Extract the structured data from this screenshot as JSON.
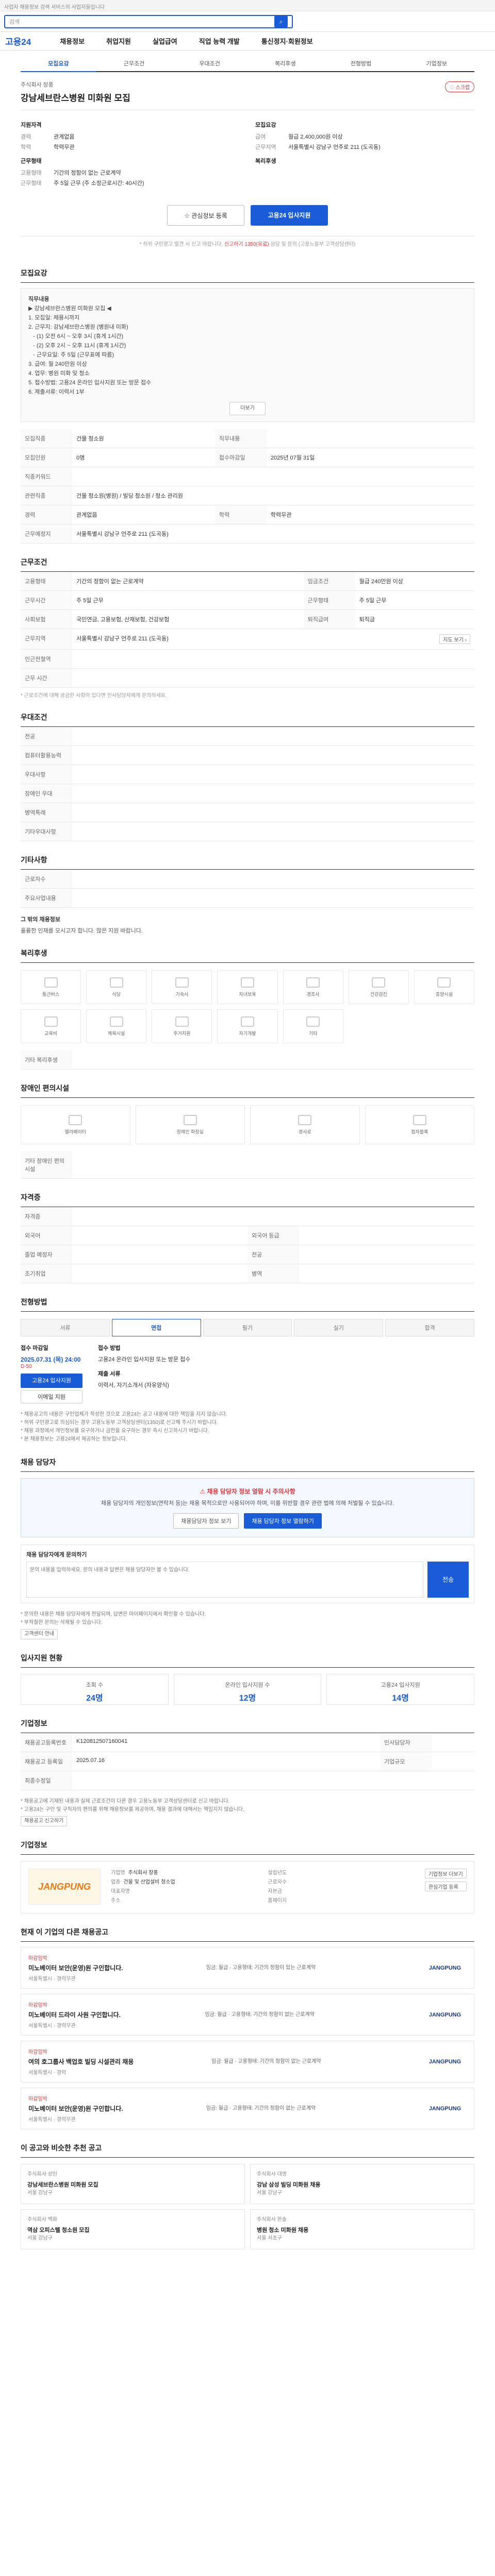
{
  "topbar": {
    "text": "사업자 채용정보 검색 서비스의 사업자들입니다"
  },
  "search": {
    "placeholder": "검색"
  },
  "gnb": {
    "logo": "고용24",
    "items": [
      "채용정보",
      "취업지원",
      "실업급여",
      "직업 능력 개발",
      "통신정지·회원정보"
    ]
  },
  "tabs": [
    "모집요강",
    "근무조건",
    "우대조건",
    "복리후생",
    "전형방법",
    "기업정보"
  ],
  "head": {
    "company": "주식회사 장풍",
    "title": "강남세브란스병원 미화원 모집",
    "scrap": "스크랩"
  },
  "summary": {
    "left_title": "지원자격",
    "left": [
      {
        "k": "경력",
        "v": "관계없음"
      },
      {
        "k": "학력",
        "v": "학력무관"
      }
    ],
    "left_title2": "근무형태",
    "left2": [
      {
        "k": "고용형태",
        "v": "기간의 정함이 없는 근로계약"
      },
      {
        "k": "근무형태",
        "v": "주 5일 근무 (주 소정근로시간: 40시간)"
      }
    ],
    "right_title": "모집요강",
    "right": [
      {
        "k": "급여",
        "v": "월급 2,400,000원 이상"
      },
      {
        "k": "근무지역",
        "v": "서울특별시 강남구 언주로 211 (도곡동)"
      }
    ],
    "right_title2": "복리후생",
    "right2": [
      {
        "k": "",
        "v": ""
      }
    ]
  },
  "apply": {
    "btn1": "관심정보 등록",
    "btn2": "고용24 입사지원",
    "notice_pre": "* 허위 구인광고 발견 시 신고 바랍니다.",
    "notice_link": "신고하기 1350(유료)",
    "notice_post": "상담 및 문의 (고용노동부 고객상담센터)"
  },
  "recruit": {
    "title": "모집요강",
    "box_lines": [
      "직무내용",
      "▶ 강남세브란스병원 미화원 모집 ◀",
      "1. 모집일: 채용시까지",
      "2. 근무지: 강남세브란스병원 (병원내 미화)",
      "   - (1) 오전 6시 ~ 오후 3시 (휴게 1시간)",
      "   - (2) 오후 2시 ~ 오후 11시 (휴게 1시간)",
      "   - 근무요일: 주 5일 (근무표에 따름)",
      "3. 급여: 월 240만원 이상",
      "4. 업무: 병원 미화 및 청소",
      "5. 접수방법: 고용24 온라인 입사지원 또는 방문 접수",
      "6. 제출서류: 이력서 1부"
    ],
    "more": "더보기"
  },
  "recruit_table": [
    {
      "k": "모집직종",
      "v": "건물 청소원"
    },
    {
      "k": "직무내용",
      "v": ""
    },
    {
      "k": "모집인원",
      "v": "0명"
    },
    {
      "k": "접수마감일",
      "v": "2025년 07월 31일"
    },
    {
      "k": "직종키워드",
      "v": ""
    },
    {
      "k": "관련직종",
      "v": "건물 청소원(병원) / 빌딩 청소원 / 청소 관리원"
    },
    {
      "k": "경력",
      "v": "관계없음"
    },
    {
      "k": "학력",
      "v": "학력무관"
    },
    {
      "k": "우대조건",
      "v": ""
    },
    {
      "k": "자격면허",
      "v": ""
    },
    {
      "k": "외국어능력",
      "v": ""
    },
    {
      "k": "전공",
      "v": ""
    },
    {
      "k": "컴퓨터활용능력",
      "v": ""
    },
    {
      "k": "근무예정지",
      "v": "서울특별시 강남구 언주로 211 (도곡동)"
    }
  ],
  "work": {
    "title": "근무조건",
    "rows": [
      {
        "k": "고용형태",
        "v": "기간의 정함이 없는 근로계약",
        "k2": "임금조건",
        "v2": "월급 240만원 이상"
      },
      {
        "k": "근무시간",
        "v": "주 5일 근무",
        "k2": "근무형태",
        "v2": "주 5일 근무"
      },
      {
        "k": "사회보험",
        "v": "국민연금, 고용보험, 산재보험, 건강보험",
        "k2": "퇴직급여",
        "v2": "퇴직금"
      },
      {
        "k": "근무지역",
        "v": "서울특별시 강남구 언주로 211 (도곡동)",
        "k2": "",
        "v2": ""
      },
      {
        "k": "인근전철역",
        "v": "",
        "k2": "",
        "v2": ""
      },
      {
        "k": "근무 시간",
        "v": "",
        "k2": "",
        "v2": ""
      }
    ],
    "note": "* 근로조건에 대해 궁금한 사항이 있다면 인사담당자에게 문의하세요."
  },
  "prefer": {
    "title": "우대조건",
    "rows": [
      {
        "k": "전공",
        "v": ""
      },
      {
        "k": "컴퓨터활용능력",
        "v": ""
      },
      {
        "k": "우대사항",
        "v": ""
      },
      {
        "k": "장애인 우대",
        "v": ""
      },
      {
        "k": "병역특례",
        "v": ""
      },
      {
        "k": "기타우대사항",
        "v": ""
      }
    ]
  },
  "etc": {
    "title": "기타사항",
    "rows": [
      {
        "k": "근로자수",
        "v": ""
      },
      {
        "k": "주요사업내용",
        "v": ""
      }
    ],
    "note_title": "그 밖의 채용정보",
    "note": "훌륭한 인재를 모시고자 합니다. 많은 지원 바랍니다."
  },
  "welfare": {
    "title": "복리후생",
    "icons": [
      "통근버스",
      "식당",
      "기숙사",
      "자녀보육",
      "경조사",
      "건강검진",
      "휴양시설",
      "교육비",
      "체육시설",
      "주거지원",
      "자기개발",
      "기타"
    ],
    "extra_title": "기타 복리후생",
    "extra": ""
  },
  "disabled": {
    "title": "장애인 편의시설",
    "icons": [
      "엘리베이터",
      "장애인 화장실",
      "경사로",
      "점자블록"
    ],
    "extra_title": "기타 장애인 편의시설",
    "extra": ""
  },
  "conditions": {
    "title": "자격증",
    "rows": [
      {
        "k": "자격증",
        "v": "",
        "k2": "",
        "v2": ""
      },
      {
        "k": "외국어",
        "v": "",
        "k2": "외국어 등급",
        "v2": ""
      },
      {
        "k": "졸업 예정자",
        "v": "",
        "k2": "전공",
        "v2": ""
      },
      {
        "k": "조기취업",
        "v": "",
        "k2": "병역",
        "v2": ""
      }
    ]
  },
  "procedure": {
    "title": "전형방법",
    "steps": [
      "서류",
      "면접",
      "필기",
      "실기",
      "합격"
    ],
    "deadline_label": "접수 마감일",
    "deadline": "2025.07.31 (목) 24:00",
    "deadline_sub": "D-50",
    "apply1": "고용24 입사지원",
    "apply2": "이메일 지원",
    "method_label": "접수 방법",
    "method": "고용24 온라인 입사지원 또는 방문 접수",
    "doc_label": "제출 서류",
    "doc": "이력서, 자기소개서 (자유양식)",
    "bullets": [
      "* 채용공고의 내용은 구인업체가 작성한 것으로 고용24는 공고 내용에 대한 책임을 지지 않습니다.",
      "* 허위 구인광고로 의심되는 경우 고용노동부 고객상담센터(1350)로 신고해 주시기 바랍니다.",
      "* 채용 과정에서 개인정보를 요구하거나 금전을 요구하는 경우 즉시 신고하시기 바랍니다.",
      "* 본 채용정보는 고용24에서 제공하는 정보입니다."
    ]
  },
  "manager": {
    "title": "채용 담당자",
    "warn": "채용 담당자 정보 열람 시 주의사항",
    "text": "채용 담당자의 개인정보(연락처 등)는 채용 목적으로만 사용되어야 하며, 이를 위반할 경우 관련 법에 의해 처벌될 수 있습니다.",
    "btn1": "채용담당자 정보 보기",
    "btn2": "채용 담당자 정보 열람하기"
  },
  "qa": {
    "title": "채용 담당자에게 문의하기",
    "placeholder": "문의 내용을 입력하세요. 문의 내용과 답변은 채용 담당자만 볼 수 있습니다.",
    "send": "전송",
    "notes": [
      "* 문의한 내용은 채용 담당자에게 전달되며, 답변은 마이페이지에서 확인할 수 있습니다.",
      "* 부적절한 문의는 삭제될 수 있습니다."
    ],
    "link": "고객센터 안내"
  },
  "stats": {
    "title": "입사지원 현황",
    "items": [
      {
        "label": "조회 수",
        "value": "24명"
      },
      {
        "label": "온라인 입사지원 수",
        "value": "12명"
      },
      {
        "label": "고용24 입사지원",
        "value": "14명"
      }
    ]
  },
  "company_info": {
    "title": "기업정보",
    "rows": [
      {
        "k": "채용공고등록번호",
        "v": "K120812507160041",
        "k2": "인사담당자",
        "v2": ""
      },
      {
        "k": "채용공고 등록일",
        "v": "2025.07.16",
        "k2": "기업규모",
        "v2": ""
      },
      {
        "k": "최종수정일",
        "v": "",
        "k2": "",
        "v2": ""
      }
    ],
    "notes": [
      "* 채용공고에 기재된 내용과 실제 근로조건이 다른 경우 고용노동부 고객상담센터로 신고 바랍니다.",
      "* 고용24는 구인 및 구직자의 편의를 위해 채용정보를 제공하며, 채용 결과에 대해서는 책임지지 않습니다."
    ],
    "link": "채용공고 신고하기"
  },
  "company": {
    "title": "기업정보",
    "logo": "JANGPUNG",
    "info": [
      {
        "k": "기업명",
        "v": "주식회사 장풍"
      },
      {
        "k": "설립년도",
        "v": ""
      },
      {
        "k": "업종",
        "v": "건물 및 산업설비 청소업"
      },
      {
        "k": "근로자수",
        "v": ""
      },
      {
        "k": "대표자명",
        "v": ""
      },
      {
        "k": "자본금",
        "v": ""
      },
      {
        "k": "주소",
        "v": ""
      },
      {
        "k": "홈페이지",
        "v": ""
      }
    ],
    "btn1": "기업정보 더보기",
    "btn2": "관심기업 등록"
  },
  "same_company": {
    "title": "현재 이 기업의 다른 채용공고",
    "items": [
      {
        "tag": "마감임박",
        "title": "미노베이터 보안(운영)원 구인합니다.",
        "meta": "서울특별시 · 경력무관",
        "right": "임금: 월급 · 고용형태: 기간의 정함이 있는 근로계약",
        "logo": "JANGPUNG"
      },
      {
        "tag": "마감임박",
        "title": "미노베이터 드라이 사원 구인합니다.",
        "meta": "서울특별시 · 경력무관",
        "right": "임금: 월급 · 고용형태: 기간의 정함이 없는 근로계약",
        "logo": "JANGPUNG"
      },
      {
        "tag": "마감임박",
        "title": "여의 호그룹사 백업호 빌딩 시설관리 채용",
        "meta": "서울특별시 · 경력",
        "right": "임금: 월급 · 고용형태: 기간의 정함이 없는 근로계약",
        "logo": "JANGPUNG"
      },
      {
        "tag": "마감임박",
        "title": "미노베이터 보안(운영)원 구인합니다.",
        "meta": "서울특별시 · 경력무관",
        "right": "임금: 월급 · 고용형태: 기간의 정함이 없는 근로계약",
        "logo": "JANGPUNG"
      }
    ]
  },
  "recommend": {
    "title": "이 공고와 비슷한 추천 공고",
    "cards": [
      {
        "company": "주식회사 성인",
        "title": "강남세브란스병원 미화원 모집",
        "tag": "서울 강남구"
      },
      {
        "company": "주식회사 대명",
        "title": "강남 삼성 빌딩 미화원 채용",
        "tag": "서울 강남구"
      },
      {
        "company": "주식회사 백화",
        "title": "역삼 오피스텔 청소원 모집",
        "tag": "서울 강남구"
      },
      {
        "company": "주식회사 한솔",
        "title": "병원 청소 미화원 채용",
        "tag": "서울 서초구"
      }
    ]
  },
  "colors": {
    "accent": "#1a5cd8",
    "alert": "#e0393e",
    "logo": "#ee7a14"
  }
}
